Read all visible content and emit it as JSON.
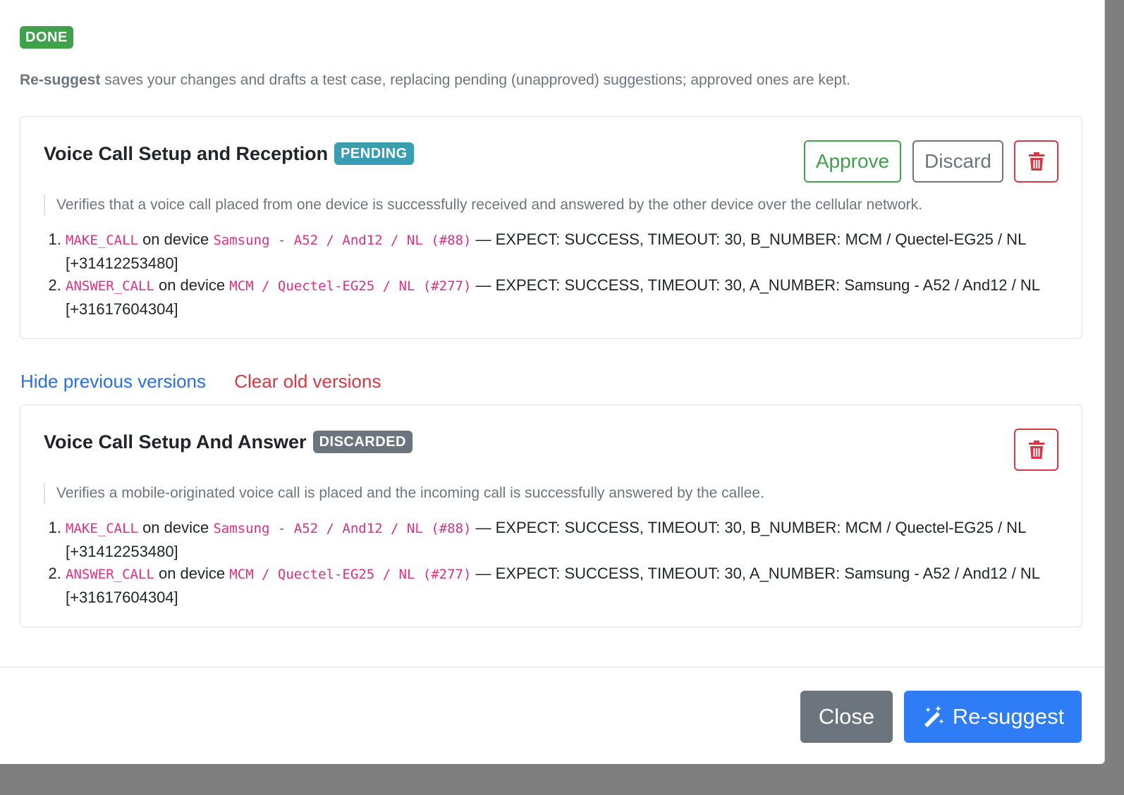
{
  "status_badge": "DONE",
  "intro": {
    "bold": "Re-suggest",
    "text": " saves your changes and drafts a test case, replacing pending (unapproved) suggestions; approved ones are kept."
  },
  "current": {
    "title": "Voice Call Setup and Reception",
    "badge": "PENDING",
    "approve_label": "Approve",
    "discard_label": "Discard",
    "description": "Verifies that a voice call placed from one device is successfully received and answered by the other device over the cellular network.",
    "steps": [
      {
        "action": "MAKE_CALL",
        "on": " on device ",
        "device": "Samsung - A52 / And12 / NL (#88)",
        "params": " — EXPECT: SUCCESS, TIMEOUT: 30, B_NUMBER: MCM / Quectel-EG25 / NL [+31412253480]"
      },
      {
        "action": "ANSWER_CALL",
        "on": " on device ",
        "device": "MCM / Quectel-EG25 / NL (#277)",
        "params": " — EXPECT: SUCCESS, TIMEOUT: 30, A_NUMBER: Samsung - A52 / And12 / NL [+31617604304]"
      }
    ]
  },
  "versions_links": {
    "hide_label": "Hide previous versions",
    "clear_label": "Clear old versions"
  },
  "previous": {
    "title": "Voice Call Setup And Answer",
    "badge": "DISCARDED",
    "description": "Verifies a mobile-originated voice call is placed and the incoming call is successfully answered by the callee.",
    "steps": [
      {
        "action": "MAKE_CALL",
        "on": " on device ",
        "device": "Samsung - A52 / And12 / NL (#88)",
        "params": " — EXPECT: SUCCESS, TIMEOUT: 30, B_NUMBER: MCM / Quectel-EG25 / NL [+31412253480]"
      },
      {
        "action": "ANSWER_CALL",
        "on": " on device ",
        "device": "MCM / Quectel-EG25 / NL (#277)",
        "params": " — EXPECT: SUCCESS, TIMEOUT: 30, A_NUMBER: Samsung - A52 / And12 / NL [+31617604304]"
      }
    ]
  },
  "footer": {
    "close_label": "Close",
    "resuggest_label": "Re-suggest"
  },
  "icons": {
    "delete": "trash-icon",
    "resuggest": "magic-wand-icon"
  },
  "colors": {
    "done": "#3fa14b",
    "pending": "#3b9db1",
    "discarded": "#6c757d",
    "primary": "#2e7cf6",
    "danger": "#d33a45",
    "code": "#d63384"
  }
}
